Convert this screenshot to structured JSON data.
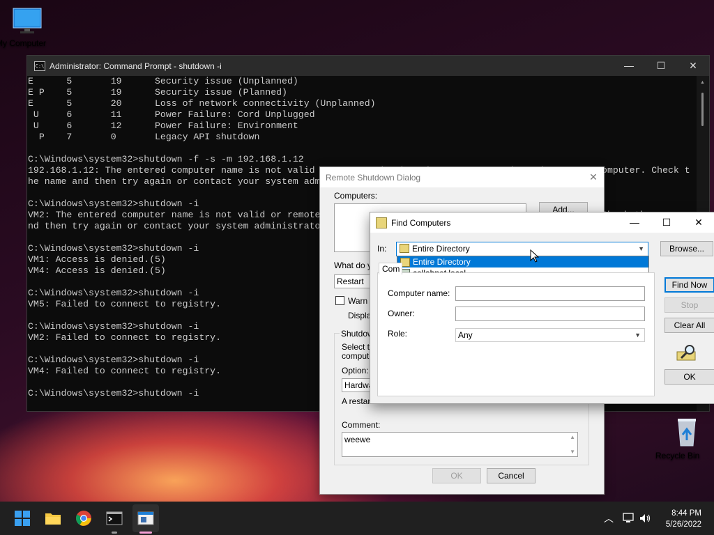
{
  "desktop": {
    "my_computer_label": "My Computer",
    "recycle_bin_label": "Recycle Bin"
  },
  "cmd": {
    "title": "Administrator: Command Prompt - shutdown  -i",
    "icon_label": "C:\\",
    "lines": [
      "E      5       19      Security issue (Unplanned)",
      "E P    5       19      Security issue (Planned)",
      "E      5       20      Loss of network connectivity (Unplanned)",
      " U     6       11      Power Failure: Cord Unplugged",
      " U     6       12      Power Failure: Environment",
      "  P    7       0       Legacy API shutdown",
      "",
      "C:\\Windows\\system32>shutdown -f -s -m 192.168.1.12",
      "192.168.1.12: The entered computer name is not valid or remote shutdown is not supported on the target computer. Check t",
      "he name and then try again or contact your system administrator.",
      "",
      "C:\\Windows\\system32>shutdown -i",
      "VM2: The entered computer name is not valid or remote shutdown is not supported on the target computer. Check the name a",
      "nd then try again or contact your system administrator.",
      "",
      "C:\\Windows\\system32>shutdown -i",
      "VM1: Access is denied.(5)",
      "VM4: Access is denied.(5)",
      "",
      "C:\\Windows\\system32>shutdown -i",
      "VM5: Failed to connect to registry.",
      "",
      "C:\\Windows\\system32>shutdown -i",
      "VM2: Failed to connect to registry.",
      "",
      "C:\\Windows\\system32>shutdown -i",
      "VM4: Failed to connect to registry.",
      "",
      "C:\\Windows\\system32>shutdown -i"
    ]
  },
  "remote_shutdown": {
    "title": "Remote Shutdown Dialog",
    "computers_label": "Computers:",
    "add_button": "Add...",
    "what_do_label": "What do y",
    "action_value": "Restart",
    "warn_label": "Warn u",
    "display_label": "Display",
    "shutdown_group_label": "Shutdow",
    "select_text_1": "Select th",
    "select_text_2": "compute",
    "option_label": "Option:",
    "option_value": "Hardwa",
    "restart_note": "A restart",
    "comment_label": "Comment:",
    "comment_value": "weewe",
    "ok_button": "OK",
    "cancel_button": "Cancel"
  },
  "find_computers": {
    "title": "Find Computers",
    "in_label": "In:",
    "in_value": "Entire Directory",
    "dropdown_options": [
      "Entire Directory",
      "collabnet.local"
    ],
    "browse_button": "Browse...",
    "tab_label": "Com",
    "computer_name_label": "Computer name:",
    "owner_label": "Owner:",
    "role_label": "Role:",
    "role_value": "Any",
    "find_now_button": "Find Now",
    "stop_button": "Stop",
    "clear_all_button": "Clear All",
    "ok_button": "OK"
  },
  "taskbar": {
    "time": "8:44 PM",
    "date": "5/26/2022"
  }
}
